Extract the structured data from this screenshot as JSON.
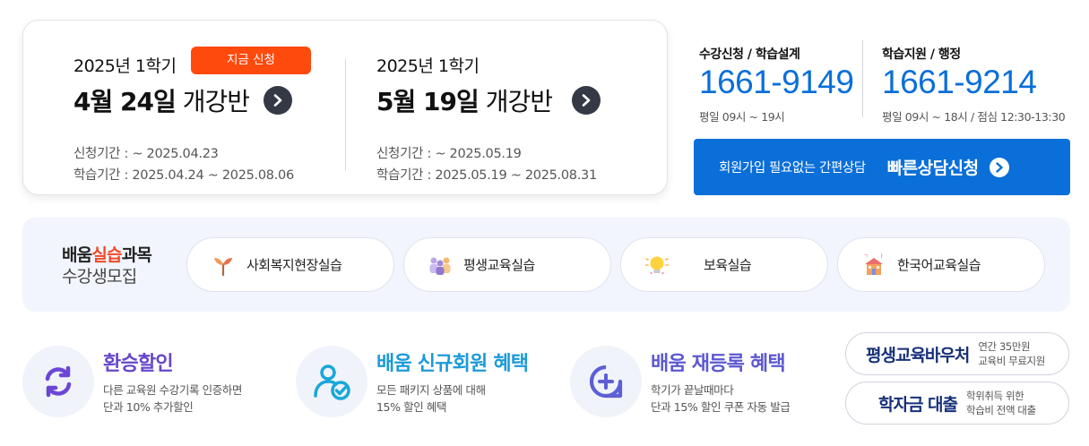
{
  "courses": [
    {
      "semester": "2025년 1학기",
      "date": "4월 24일",
      "suffix": "개강반",
      "apply_period": "신청기간 : ~ 2025.04.23",
      "study_period": "학습기간 : 2025.04.24 ~ 2025.08.06"
    },
    {
      "semester": "2025년 1학기",
      "date": "5월 19일",
      "suffix": "개강반",
      "apply_period": "신청기간 : ~ 2025.05.19",
      "study_period": "학습기간 : 2025.05.19 ~ 2025.08.31"
    }
  ],
  "badge": {
    "label": "지금 신청",
    "color": "#ff4a0d"
  },
  "contacts": [
    {
      "label": "수강신청 / 학습설계",
      "number": "1661-9149",
      "hours": "평일 09시 ~ 19시"
    },
    {
      "label": "학습지원 / 행정",
      "number": "1661-9214",
      "hours": "평일 09시 ~ 18시 / 점심 12:30-13:30"
    }
  ],
  "quick_consult": {
    "sub": "회원가입 필요없는 간편상담",
    "main": "빠른상담신청",
    "color": "#0a6fd8"
  },
  "practicum": {
    "title_a": "배움",
    "title_hl": "실습",
    "title_b": "과목",
    "title_line2": "수강생모집",
    "items": [
      {
        "label": "사회복지현장실습",
        "icon": "sprout-icon"
      },
      {
        "label": "평생교육실습",
        "icon": "people-icon"
      },
      {
        "label": "보육실습",
        "icon": "lightbulb-icon"
      },
      {
        "label": "한국어교육실습",
        "icon": "building-icon"
      }
    ]
  },
  "benefits": [
    {
      "title": "환승할인",
      "line1": "다른 교육원 수강기록 인증하면",
      "line2": "단과 10% 추가할인",
      "icon": "refresh-icon"
    },
    {
      "title": "배움 신규회원 혜택",
      "line1": "모든 패키지 상품에 대해",
      "line2": "15% 할인 혜택",
      "icon": "user-check-icon"
    },
    {
      "title": "배움 재등록 혜택",
      "line1": "학기가 끝날때마다",
      "line2": "단과 15% 할인 쿠폰 자동 발급",
      "icon": "chat-plus-icon"
    }
  ],
  "vouchers": [
    {
      "logo": "평생교육바우처",
      "line1": "연간 35만원",
      "line2": "교육비 무료지원"
    },
    {
      "logo": "학자금 대출",
      "line1": "학위취득 위한",
      "line2": "학습비 전액 대출"
    }
  ]
}
